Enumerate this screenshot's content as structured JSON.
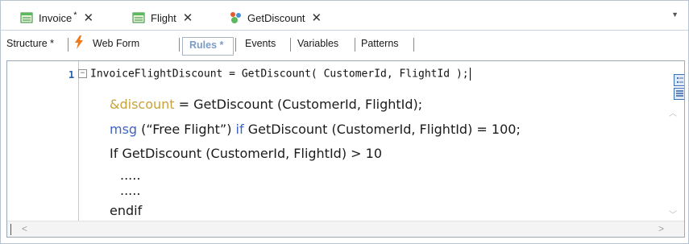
{
  "tabs": [
    {
      "label": "Invoice",
      "modified_mark": "*",
      "close": "✕",
      "icon": "invoice-object-icon"
    },
    {
      "label": "Flight",
      "close": "✕",
      "icon": "transaction-icon"
    },
    {
      "label": "GetDiscount",
      "close": "✕",
      "icon": "procedure-icon"
    }
  ],
  "toolbar": {
    "structure": "Structure *",
    "webform": "Web Form",
    "rules": "Rules *",
    "events": "Events",
    "variables": "Variables",
    "patterns": "Patterns"
  },
  "editor": {
    "line_number": "1",
    "line1": "InvoiceFlightDiscount = GetDiscount( CustomerId, FlightId );",
    "line2_var": "&discount",
    "line2_rest": " = GetDiscount (CustomerId, FlightId);",
    "line3_kw1": "msg",
    "line3_mid": " (“Free Flight”) ",
    "line3_kw2": "if",
    "line3_rest": " GetDiscount (CustomerId, FlightId) = 100;",
    "line4": "If GetDiscount (CustomerId, FlightId) > 10",
    "line5": ".....",
    "line6": ".....",
    "line7": "endif"
  },
  "colors": {
    "variable": "#c7a23d",
    "keyword": "#3d63c8",
    "rules_tab": "#7a9cc6",
    "line_number": "#2b5fa8"
  }
}
